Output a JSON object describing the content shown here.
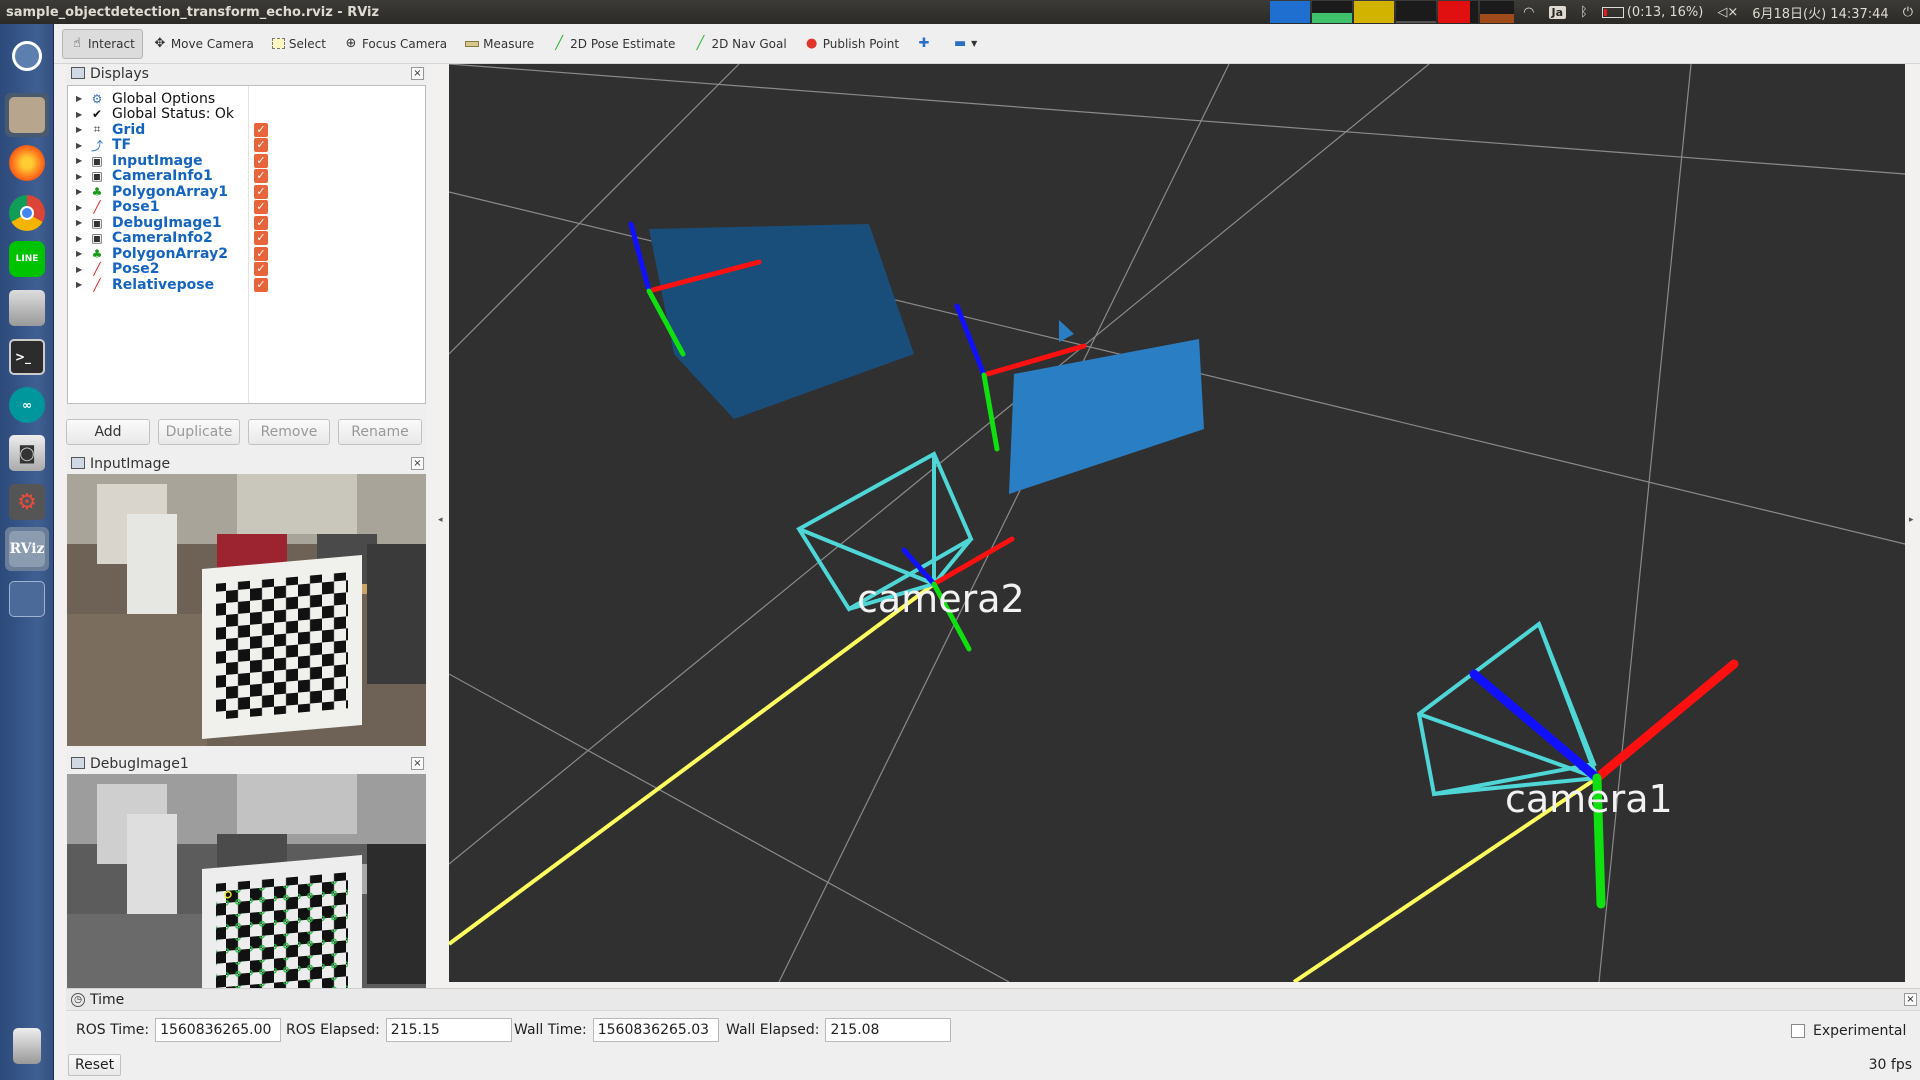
{
  "window": {
    "title": "sample_objectdetection_transform_echo.rviz - RViz"
  },
  "system_tray": {
    "keyboard": "Ja",
    "battery": "(0:13, 16%)",
    "datetime": "6月18日(火) 14:37:44",
    "meter_colors": [
      "#1f6fd0",
      "#3fc06a",
      "#d2b300",
      "#2b2b2b",
      "#e01010"
    ]
  },
  "launcher": {
    "items": [
      "ubuntu-dash",
      "files",
      "firefox",
      "chrome",
      "line",
      "disk",
      "terminal",
      "arduino",
      "camera",
      "settings",
      "rviz",
      "workspace",
      "trash"
    ],
    "rviz_label": "RViz",
    "line_label": "LINE"
  },
  "toolbar": {
    "tools": [
      {
        "label": "Interact",
        "icon": "hand-icon"
      },
      {
        "label": "Move Camera",
        "icon": "move-icon"
      },
      {
        "label": "Select",
        "icon": "select-icon"
      },
      {
        "label": "Focus Camera",
        "icon": "focus-icon"
      },
      {
        "label": "Measure",
        "icon": "ruler-icon"
      },
      {
        "label": "2D Pose Estimate",
        "icon": "pose-estimate-icon"
      },
      {
        "label": "2D Nav Goal",
        "icon": "nav-goal-icon"
      },
      {
        "label": "Publish Point",
        "icon": "pin-icon"
      }
    ]
  },
  "displays": {
    "title": "Displays",
    "items": [
      {
        "label": "Global Options",
        "checked": false,
        "enabled_style": false
      },
      {
        "label": "Global Status: Ok",
        "checked": false,
        "enabled_style": false
      },
      {
        "label": "Grid",
        "checked": true,
        "enabled_style": true
      },
      {
        "label": "TF",
        "checked": true,
        "enabled_style": true
      },
      {
        "label": "InputImage",
        "checked": true,
        "enabled_style": true
      },
      {
        "label": "CameraInfo1",
        "checked": true,
        "enabled_style": true
      },
      {
        "label": "PolygonArray1",
        "checked": true,
        "enabled_style": true
      },
      {
        "label": "Pose1",
        "checked": true,
        "enabled_style": true
      },
      {
        "label": "DebugImage1",
        "checked": true,
        "enabled_style": true
      },
      {
        "label": "CameraInfo2",
        "checked": true,
        "enabled_style": true
      },
      {
        "label": "PolygonArray2",
        "checked": true,
        "enabled_style": true
      },
      {
        "label": "Pose2",
        "checked": true,
        "enabled_style": true
      },
      {
        "label": "Relativepose",
        "checked": true,
        "enabled_style": true
      }
    ],
    "buttons": {
      "add": "Add",
      "duplicate": "Duplicate",
      "remove": "Remove",
      "rename": "Rename"
    }
  },
  "image_panels": {
    "input": {
      "title": "InputImage"
    },
    "debug": {
      "title": "DebugImage1"
    }
  },
  "view3d": {
    "camera_labels": [
      "camera2",
      "camera1"
    ],
    "colors": {
      "background": "#303030",
      "frustum": "#4fd6d6",
      "x_axis": "#ff1010",
      "y_axis": "#10e010",
      "z_axis": "#1010ff",
      "link": "#ffff50",
      "polygon1": "#1a4e7a",
      "polygon2": "#2a7fc4"
    }
  },
  "time_panel": {
    "title": "Time",
    "ros_time_label": "ROS Time:",
    "ros_time": "1560836265.00",
    "ros_elapsed_label": "ROS Elapsed:",
    "ros_elapsed": "215.15",
    "wall_time_label": "Wall Time:",
    "wall_time": "1560836265.03",
    "wall_elapsed_label": "Wall Elapsed:",
    "wall_elapsed": "215.08",
    "experimental_label": "Experimental",
    "reset_label": "Reset",
    "fps": "30 fps"
  }
}
